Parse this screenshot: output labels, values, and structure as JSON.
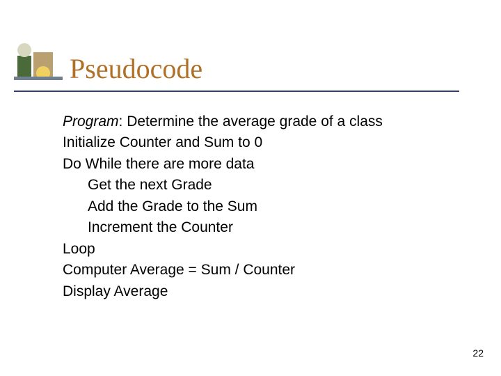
{
  "slide": {
    "title": "Pseudocode",
    "program_label": "Program",
    "program_desc": ": Determine the average grade of a class",
    "lines": {
      "l1": "Initialize Counter and Sum to 0",
      "l2": "Do While there are more data",
      "l3": "Get the next Grade",
      "l4": "Add the Grade to the Sum",
      "l5": "Increment the Counter",
      "l6": "Loop",
      "l7": "Computer Average = Sum / Counter",
      "l8": "Display Average"
    },
    "page_number": "22"
  }
}
